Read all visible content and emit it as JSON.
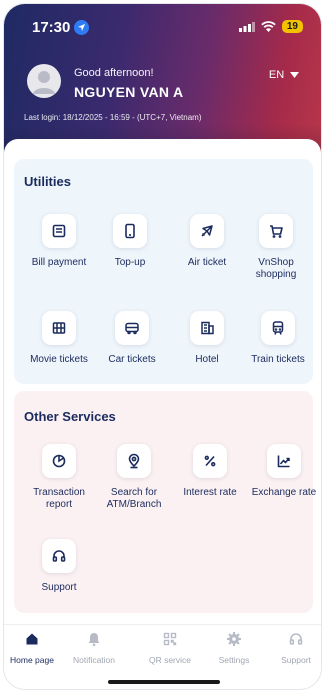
{
  "status_bar": {
    "time": "17:30",
    "battery": "19"
  },
  "header": {
    "greeting": "Good afternoon!",
    "username": "NGUYEN VAN A",
    "language": "EN",
    "last_login": "Last login: 18/12/2025 - 16:59 - (UTC+7, Vietnam)"
  },
  "utilities": {
    "title": "Utilities",
    "items": [
      {
        "label": "Bill payment",
        "icon": "receipt-icon"
      },
      {
        "label": "Top-up",
        "icon": "phone-icon"
      },
      {
        "label": "Air ticket",
        "icon": "plane-icon"
      },
      {
        "label": "VnShop shopping",
        "icon": "cart-icon"
      },
      {
        "label": "Movie tickets",
        "icon": "film-icon"
      },
      {
        "label": "Car tickets",
        "icon": "bus-icon"
      },
      {
        "label": "Hotel",
        "icon": "hotel-icon"
      },
      {
        "label": "Train tickets",
        "icon": "train-icon"
      }
    ]
  },
  "other_services": {
    "title": "Other Services",
    "items": [
      {
        "label": "Transaction report",
        "icon": "pie-chart-icon"
      },
      {
        "label": "Search for ATM/Branch",
        "icon": "map-pin-icon"
      },
      {
        "label": "Interest rate",
        "icon": "percent-icon"
      },
      {
        "label": "Exchange rate",
        "icon": "trend-chart-icon"
      },
      {
        "label": "Support",
        "icon": "headset-icon"
      }
    ]
  },
  "bottom_nav": {
    "items": [
      {
        "label": "Home page",
        "icon": "home-icon",
        "active": true
      },
      {
        "label": "Notification",
        "icon": "bell-icon",
        "active": false
      },
      {
        "label": "QR service",
        "icon": "qr-icon",
        "active": false
      },
      {
        "label": "Settings",
        "icon": "gear-icon",
        "active": false
      },
      {
        "label": "Support",
        "icon": "headset-icon",
        "active": false
      }
    ]
  },
  "colors": {
    "accent": "#1b2b5e",
    "inactive": "#a0a6b2"
  }
}
